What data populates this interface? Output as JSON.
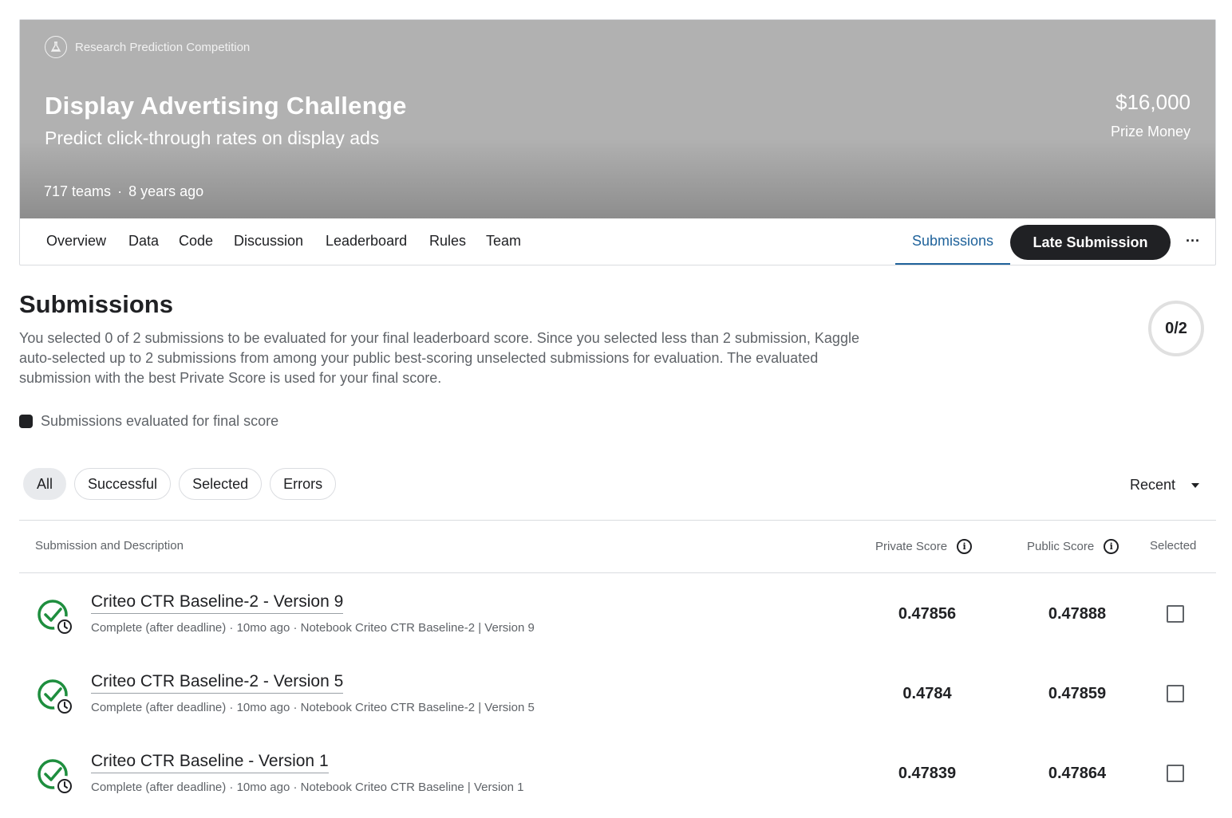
{
  "competition": {
    "type_label": "Research Prediction Competition",
    "title": "Display Advertising Challenge",
    "subtitle": "Predict click-through rates on display ads",
    "prize_amount": "$16,000",
    "prize_label": "Prize Money",
    "teams": "717 teams",
    "separator": "·",
    "age": "8 years ago"
  },
  "tabs": {
    "overview": "Overview",
    "data": "Data",
    "code": "Code",
    "discussion": "Discussion",
    "leaderboard": "Leaderboard",
    "rules": "Rules",
    "team": "Team",
    "submissions": "Submissions",
    "late_submission": "Late Submission",
    "more": "···"
  },
  "section": {
    "title": "Submissions",
    "description": "You selected 0 of 2 submissions to be evaluated for your final leaderboard score. Since you selected less than 2 submission, Kaggle auto-selected up to 2 submissions from among your public best-scoring unselected submissions for evaluation. The evaluated submission with the best Private Score is used for your final score.",
    "selected_count": "0/2",
    "legend": "Submissions evaluated for final score"
  },
  "filters": {
    "all": "All",
    "successful": "Successful",
    "selected": "Selected",
    "errors": "Errors",
    "sort": "Recent"
  },
  "table": {
    "col_submission": "Submission and Description",
    "col_private": "Private Score",
    "col_public": "Public Score",
    "col_selected": "Selected",
    "rows": [
      {
        "title": "Criteo CTR Baseline-2 - Version 9",
        "meta": "Complete (after deadline) · 10mo ago · Notebook Criteo CTR Baseline-2 | Version 9",
        "private": "0.47856",
        "public": "0.47888"
      },
      {
        "title": "Criteo CTR Baseline-2 - Version 5",
        "meta": "Complete (after deadline) · 10mo ago · Notebook Criteo CTR Baseline-2 | Version 5",
        "private": "0.4784",
        "public": "0.47859"
      },
      {
        "title": "Criteo CTR Baseline - Version 1",
        "meta": "Complete (after deadline) · 10mo ago · Notebook Criteo CTR Baseline | Version 1",
        "private": "0.47839",
        "public": "0.47864"
      }
    ]
  },
  "colors": {
    "accent": "#20639b",
    "success": "#1e8e3e",
    "dark": "#202124"
  }
}
